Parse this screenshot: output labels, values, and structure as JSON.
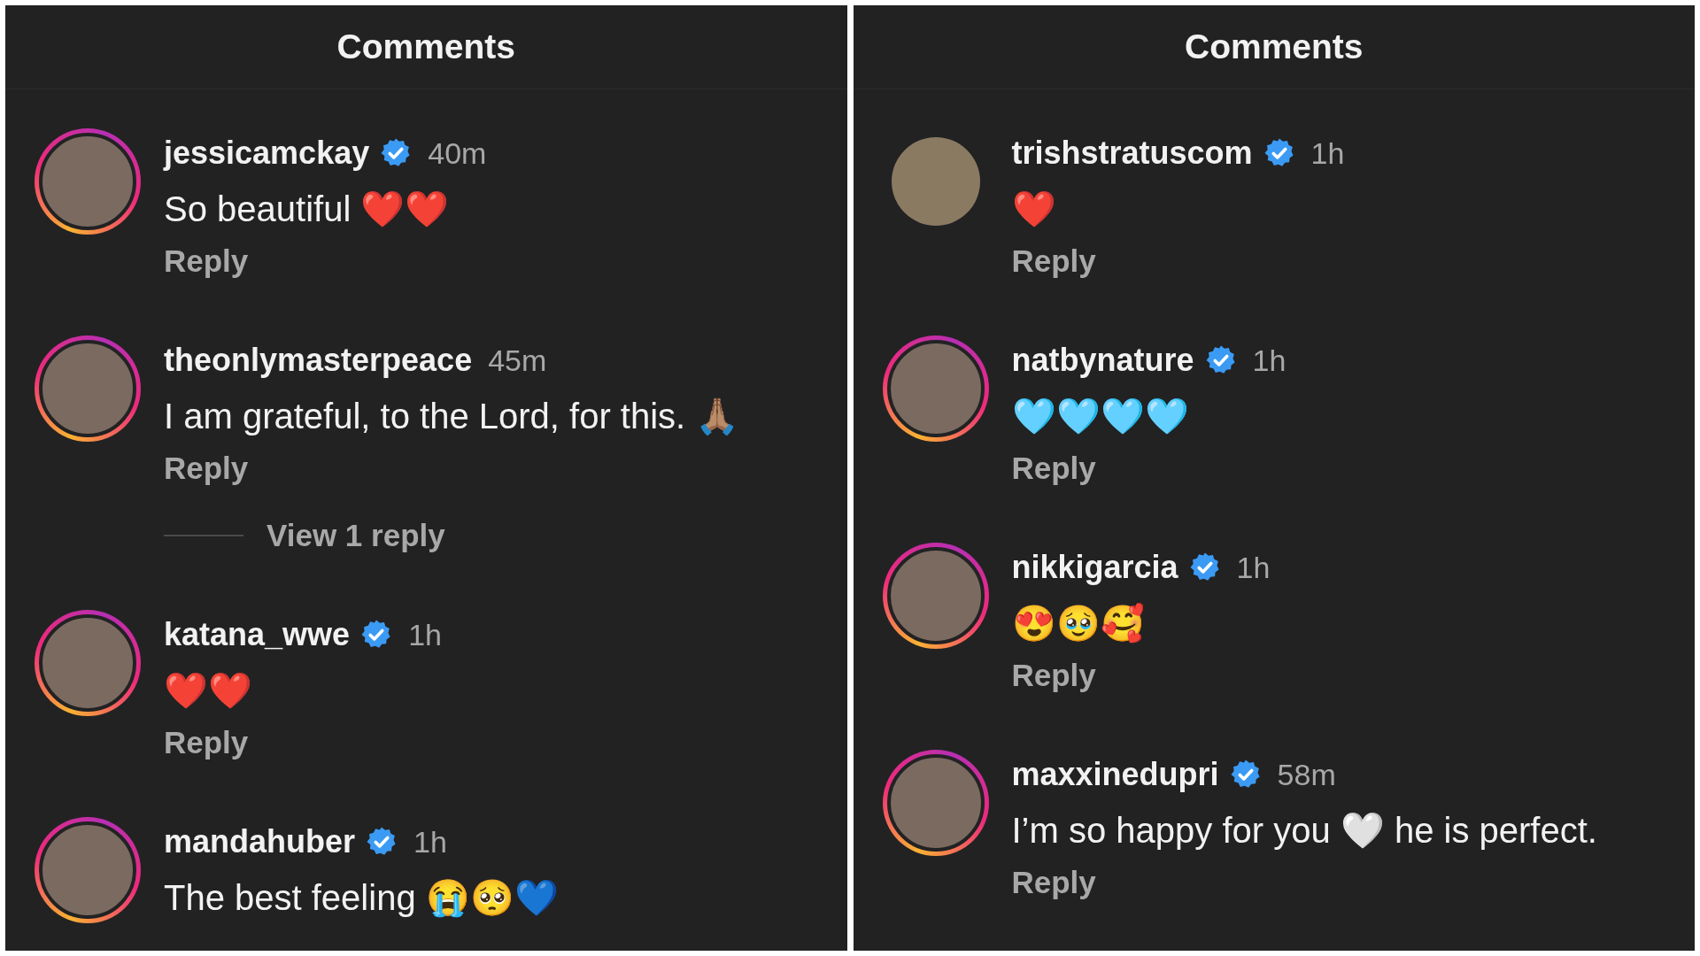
{
  "panels": [
    {
      "title": "Comments",
      "comments": [
        {
          "username": "jessicamckay",
          "verified": true,
          "story_ring": true,
          "time": "40m",
          "text": "So beautiful ❤️❤️",
          "reply": "Reply"
        },
        {
          "username": "theonlymasterpeace",
          "verified": false,
          "story_ring": true,
          "time": "45m",
          "text": "I am grateful, to the Lord, for this. 🙏🏽",
          "reply": "Reply",
          "view_replies": "View 1 reply"
        },
        {
          "username": "katana_wwe",
          "verified": true,
          "story_ring": true,
          "time": "1h",
          "text": "❤️❤️",
          "reply": "Reply"
        },
        {
          "username": "mandahuber",
          "verified": true,
          "story_ring": true,
          "time": "1h",
          "text": "The best feeling 😭🥺💙"
        }
      ]
    },
    {
      "title": "Comments",
      "comments": [
        {
          "username": "trishstratuscom",
          "verified": true,
          "story_ring": false,
          "time": "1h",
          "text": "❤️",
          "reply": "Reply"
        },
        {
          "username": "natbynature",
          "verified": true,
          "story_ring": true,
          "time": "1h",
          "text": "🩵🩵🩵🩵",
          "reply": "Reply"
        },
        {
          "username": "nikkigarcia",
          "verified": true,
          "story_ring": true,
          "time": "1h",
          "text": "😍🥹🥰",
          "reply": "Reply"
        },
        {
          "username": "maxxinedupri",
          "verified": true,
          "story_ring": true,
          "time": "58m",
          "text": "I’m so happy for you 🤍 he is perfect.",
          "reply": "Reply"
        }
      ]
    }
  ]
}
